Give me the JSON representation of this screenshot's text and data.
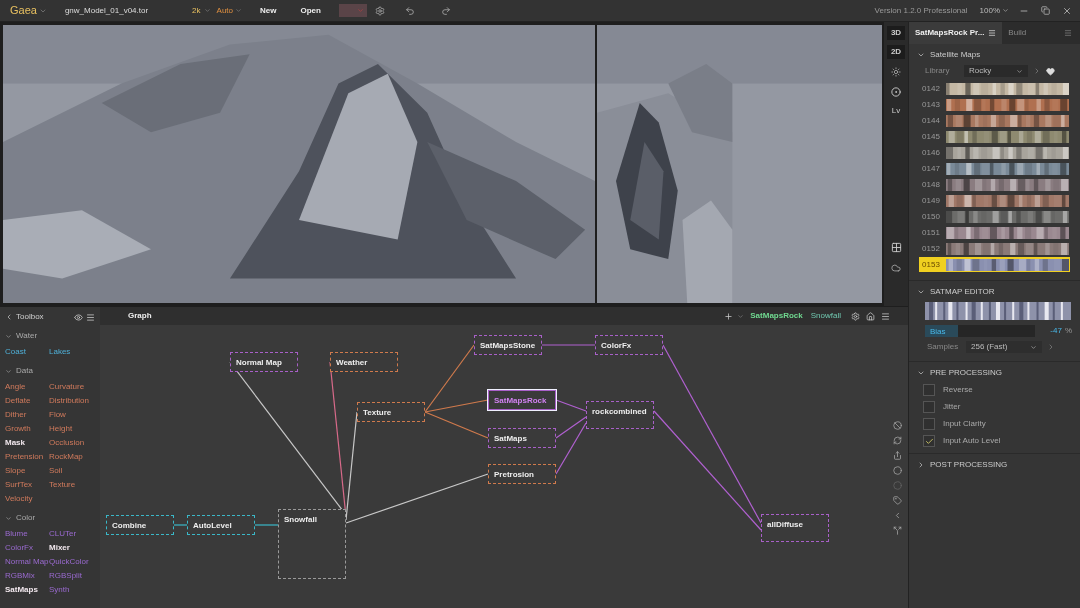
{
  "top_bar": {
    "app": "Gaea",
    "file": "gnw_Model_01_v04.tor",
    "resolution": "2k",
    "mode": "Auto",
    "buttons": [
      "New",
      "Open"
    ],
    "version": "Version 1.2.0 Professional",
    "zoom": "100%"
  },
  "view_toolbar": {
    "buttons": [
      {
        "label": "3D",
        "selected": false
      },
      {
        "label": "2D",
        "selected": false
      }
    ],
    "lv": "Lv"
  },
  "toolbox": {
    "title": "Toolbox",
    "sections": [
      {
        "title": "Water",
        "kind": "water",
        "items": [
          {
            "label": "Coast",
            "highlighted": false
          },
          {
            "label": "Lakes",
            "highlighted": false
          }
        ]
      },
      {
        "title": "Data",
        "kind": "data",
        "items": [
          {
            "label": "Angle",
            "highlighted": false
          },
          {
            "label": "Curvature",
            "highlighted": false
          },
          {
            "label": "Deflate",
            "highlighted": false
          },
          {
            "label": "Distribution",
            "highlighted": false
          },
          {
            "label": "Dither",
            "highlighted": false
          },
          {
            "label": "Flow",
            "highlighted": false
          },
          {
            "label": "Growth",
            "highlighted": false
          },
          {
            "label": "Height",
            "highlighted": false
          },
          {
            "label": "Mask",
            "highlighted": true
          },
          {
            "label": "Occlusion",
            "highlighted": false
          },
          {
            "label": "Pretension",
            "highlighted": false
          },
          {
            "label": "RockMap",
            "highlighted": false
          },
          {
            "label": "Slope",
            "highlighted": false
          },
          {
            "label": "Soil",
            "highlighted": false
          },
          {
            "label": "SurfTex",
            "highlighted": false
          },
          {
            "label": "Texture",
            "highlighted": false
          },
          {
            "label": "Velocity",
            "highlighted": false
          }
        ]
      },
      {
        "title": "Color",
        "kind": "color",
        "items": [
          {
            "label": "Blume",
            "highlighted": false
          },
          {
            "label": "CLUTer",
            "highlighted": false
          },
          {
            "label": "ColorFx",
            "highlighted": false
          },
          {
            "label": "Mixer",
            "highlighted": true
          },
          {
            "label": "Normal Map",
            "highlighted": false
          },
          {
            "label": "QuickColor",
            "highlighted": false
          },
          {
            "label": "RGBMix",
            "highlighted": false
          },
          {
            "label": "RGBSplit",
            "highlighted": false
          },
          {
            "label": "SatMaps",
            "highlighted": true
          },
          {
            "label": "Synth",
            "highlighted": false
          }
        ]
      }
    ]
  },
  "graph": {
    "title": "Graph",
    "active_node": "SatMapsRock",
    "secondary_node": "Snowfall",
    "nodes": [
      {
        "label": "Normal Map",
        "kind": "color",
        "selected": false
      },
      {
        "label": "Weather",
        "kind": "data",
        "selected": false
      },
      {
        "label": "SatMapsStone",
        "kind": "color",
        "selected": false
      },
      {
        "label": "ColorFx",
        "kind": "color",
        "selected": false
      },
      {
        "label": "Texture",
        "kind": "data",
        "selected": false
      },
      {
        "label": "SatMapsRock",
        "kind": "color",
        "selected": true
      },
      {
        "label": "rockcombined",
        "kind": "color",
        "selected": false
      },
      {
        "label": "SatMaps",
        "kind": "color",
        "selected": false
      },
      {
        "label": "Pretrosion",
        "kind": "data",
        "selected": false
      },
      {
        "label": "Snowfall",
        "kind": "plain",
        "selected": false
      },
      {
        "label": "Combine",
        "kind": "water",
        "selected": false
      },
      {
        "label": "AutoLevel",
        "kind": "water",
        "selected": false
      },
      {
        "label": "allDiffuse",
        "kind": "color",
        "selected": false
      }
    ]
  },
  "properties": {
    "tabs": [
      {
        "label": "SatMapsRock Pr...",
        "selected": true
      },
      {
        "label": "Build",
        "selected": false
      }
    ],
    "satellite_maps": {
      "title": "Satellite Maps",
      "expanded": true,
      "library_label": "Library",
      "library": "Rocky",
      "maps": [
        {
          "label": "0142",
          "color": "#c4b8a4",
          "selected": false
        },
        {
          "label": "0143",
          "color": "#b07050",
          "selected": false
        },
        {
          "label": "0144",
          "color": "#a87860",
          "selected": false
        },
        {
          "label": "0145",
          "color": "#8e8a70",
          "selected": false
        },
        {
          "label": "0146",
          "color": "#a8a49c",
          "selected": false
        },
        {
          "label": "0147",
          "color": "#7a8a98",
          "selected": false
        },
        {
          "label": "0148",
          "color": "#8a7c80",
          "selected": false
        },
        {
          "label": "0149",
          "color": "#a07868",
          "selected": false
        },
        {
          "label": "0150",
          "color": "#6c6c6a",
          "selected": false
        },
        {
          "label": "0151",
          "color": "#9a8890",
          "selected": false
        },
        {
          "label": "0152",
          "color": "#8a7a78",
          "selected": false
        },
        {
          "label": "0153",
          "color": "#8a90b0",
          "selected": true
        }
      ]
    },
    "editor": {
      "title": "SATMAP EDITOR",
      "expanded": true,
      "bias_label": "Bias",
      "bias": {
        "level": 0.3
      },
      "bias_value": "-47",
      "bias_unit": "%",
      "samples_label": "Samples",
      "samples": "256 (Fast)"
    },
    "pre_processing": {
      "title": "PRE PROCESSING",
      "expanded": true,
      "options": [
        {
          "label": "Reverse",
          "checked": false
        },
        {
          "label": "Jitter",
          "checked": false
        },
        {
          "label": "Input Clarity",
          "checked": false
        },
        {
          "label": "Input Auto Level",
          "checked": true
        }
      ]
    },
    "post_processing": {
      "title": "POST PROCESSING",
      "expanded": false
    }
  }
}
